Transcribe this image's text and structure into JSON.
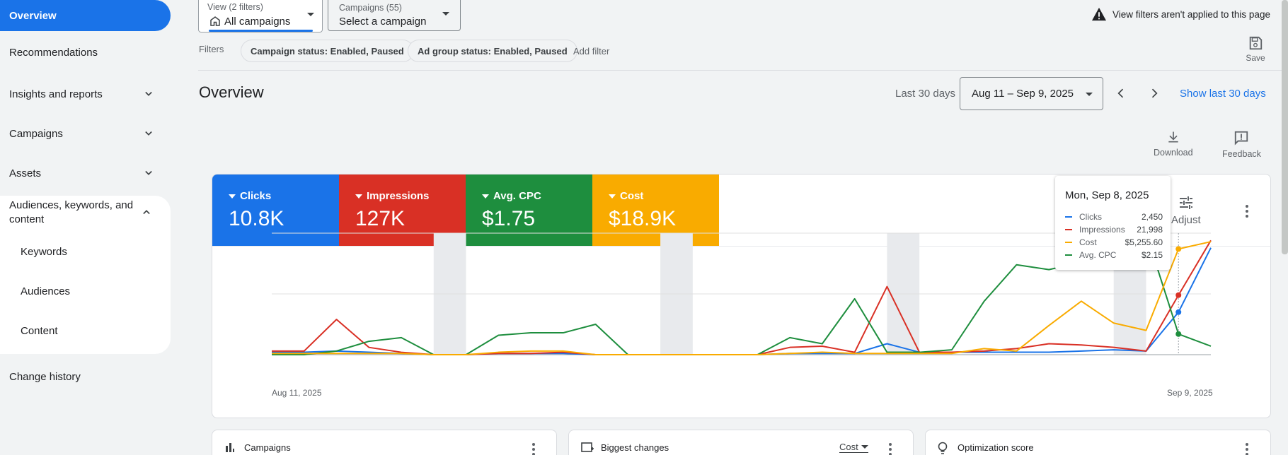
{
  "sidebar": {
    "overview": "Overview",
    "recommendations": "Recommendations",
    "insights": "Insights and reports",
    "campaigns": "Campaigns",
    "assets": "Assets",
    "audiences_group": "Audiences, keywords, and content",
    "keywords": "Keywords",
    "audiences": "Audiences",
    "content": "Content",
    "change_history": "Change history"
  },
  "topbar": {
    "view_small": "View (2 filters)",
    "view_main": "All campaigns",
    "campaigns_small": "Campaigns (55)",
    "campaigns_main": "Select a campaign",
    "warning": "View filters aren't applied to this page",
    "filters_label": "Filters",
    "chip_campaign_status": "Campaign status: Enabled, Paused",
    "chip_adgroup_status": "Ad group status: Enabled, Paused",
    "add_filter": "Add filter",
    "save": "Save"
  },
  "overview": {
    "title": "Overview",
    "range_label": "Last 30 days",
    "date_range": "Aug 11 – Sep 9, 2025",
    "show_last": "Show last 30 days",
    "download": "Download",
    "feedback": "Feedback",
    "adjust": "Adjust"
  },
  "metrics": [
    {
      "label": "Clicks",
      "value": "10.8K",
      "color": "#1a73e8"
    },
    {
      "label": "Impressions",
      "value": "127K",
      "color": "#d93025"
    },
    {
      "label": "Avg. CPC",
      "value": "$1.75",
      "color": "#1e8e3e"
    },
    {
      "label": "Cost",
      "value": "$18.9K",
      "color": "#f9ab00"
    }
  ],
  "chart_data": {
    "type": "line",
    "x_start_label": "Aug 11, 2025",
    "x_end_label": "Sep 9, 2025",
    "x": [
      "Aug 11",
      "Aug 12",
      "Aug 13",
      "Aug 14",
      "Aug 15",
      "Aug 16",
      "Aug 17",
      "Aug 18",
      "Aug 19",
      "Aug 20",
      "Aug 21",
      "Aug 22",
      "Aug 23",
      "Aug 24",
      "Aug 25",
      "Aug 26",
      "Aug 27",
      "Aug 28",
      "Aug 29",
      "Aug 30",
      "Aug 31",
      "Sep 1",
      "Sep 2",
      "Sep 3",
      "Sep 4",
      "Sep 5",
      "Sep 6",
      "Sep 7",
      "Sep 8",
      "Sep 9"
    ],
    "grid": true,
    "shaded_weekends": [
      [
        "Aug 16",
        "Aug 17"
      ],
      [
        "Aug 23",
        "Aug 24"
      ],
      [
        "Aug 30",
        "Aug 31"
      ],
      [
        "Sep 6",
        "Sep 7"
      ]
    ],
    "series": [
      {
        "name": "Clicks",
        "color": "#1a73e8",
        "values": [
          0.02,
          0.02,
          0.03,
          0.02,
          0.01,
          0.0,
          0.0,
          0.01,
          0.01,
          0.01,
          0.0,
          0.0,
          0.0,
          0.0,
          0.0,
          0.0,
          0.01,
          0.01,
          0.01,
          0.09,
          0.02,
          0.02,
          0.02,
          0.02,
          0.02,
          0.03,
          0.04,
          0.03,
          0.35,
          0.88
        ]
      },
      {
        "name": "Impressions",
        "color": "#d93025",
        "values": [
          0.03,
          0.03,
          0.29,
          0.06,
          0.02,
          0.0,
          0.0,
          0.01,
          0.01,
          0.02,
          0.0,
          0.0,
          0.0,
          0.0,
          0.0,
          0.0,
          0.06,
          0.07,
          0.02,
          0.56,
          0.02,
          0.02,
          0.03,
          0.05,
          0.09,
          0.08,
          0.06,
          0.03,
          0.49,
          0.94
        ]
      },
      {
        "name": "Avg. CPC",
        "color": "#1e8e3e",
        "values": [
          0.0,
          0.0,
          0.03,
          0.11,
          0.14,
          0.0,
          0.0,
          0.16,
          0.18,
          0.18,
          0.25,
          0.0,
          0.0,
          0.0,
          0.0,
          0.0,
          0.14,
          0.09,
          0.46,
          0.02,
          0.02,
          0.04,
          0.44,
          0.74,
          0.7,
          0.76,
          1.0,
          1.0,
          0.17,
          0.07
        ]
      },
      {
        "name": "Cost",
        "color": "#f9ab00",
        "values": [
          0.01,
          0.01,
          0.01,
          0.01,
          0.01,
          0.0,
          0.0,
          0.02,
          0.03,
          0.03,
          0.0,
          0.0,
          0.0,
          0.0,
          0.0,
          0.0,
          0.01,
          0.02,
          0.01,
          0.01,
          0.01,
          0.01,
          0.05,
          0.03,
          0.24,
          0.44,
          0.26,
          0.2,
          0.87,
          0.93
        ]
      }
    ],
    "hover_index": 28
  },
  "tooltip": {
    "date": "Mon, Sep 8, 2025",
    "rows": [
      {
        "name": "Clicks",
        "value": "2,450",
        "color": "#1a73e8"
      },
      {
        "name": "Impressions",
        "value": "21,998",
        "color": "#d93025"
      },
      {
        "name": "Cost",
        "value": "$5,255.60",
        "color": "#f9ab00"
      },
      {
        "name": "Avg. CPC",
        "value": "$2.15",
        "color": "#1e8e3e"
      }
    ]
  },
  "bottom_cards": {
    "campaigns": "Campaigns",
    "biggest_changes": "Biggest changes",
    "biggest_metric": "Cost",
    "optimization": "Optimization score"
  }
}
